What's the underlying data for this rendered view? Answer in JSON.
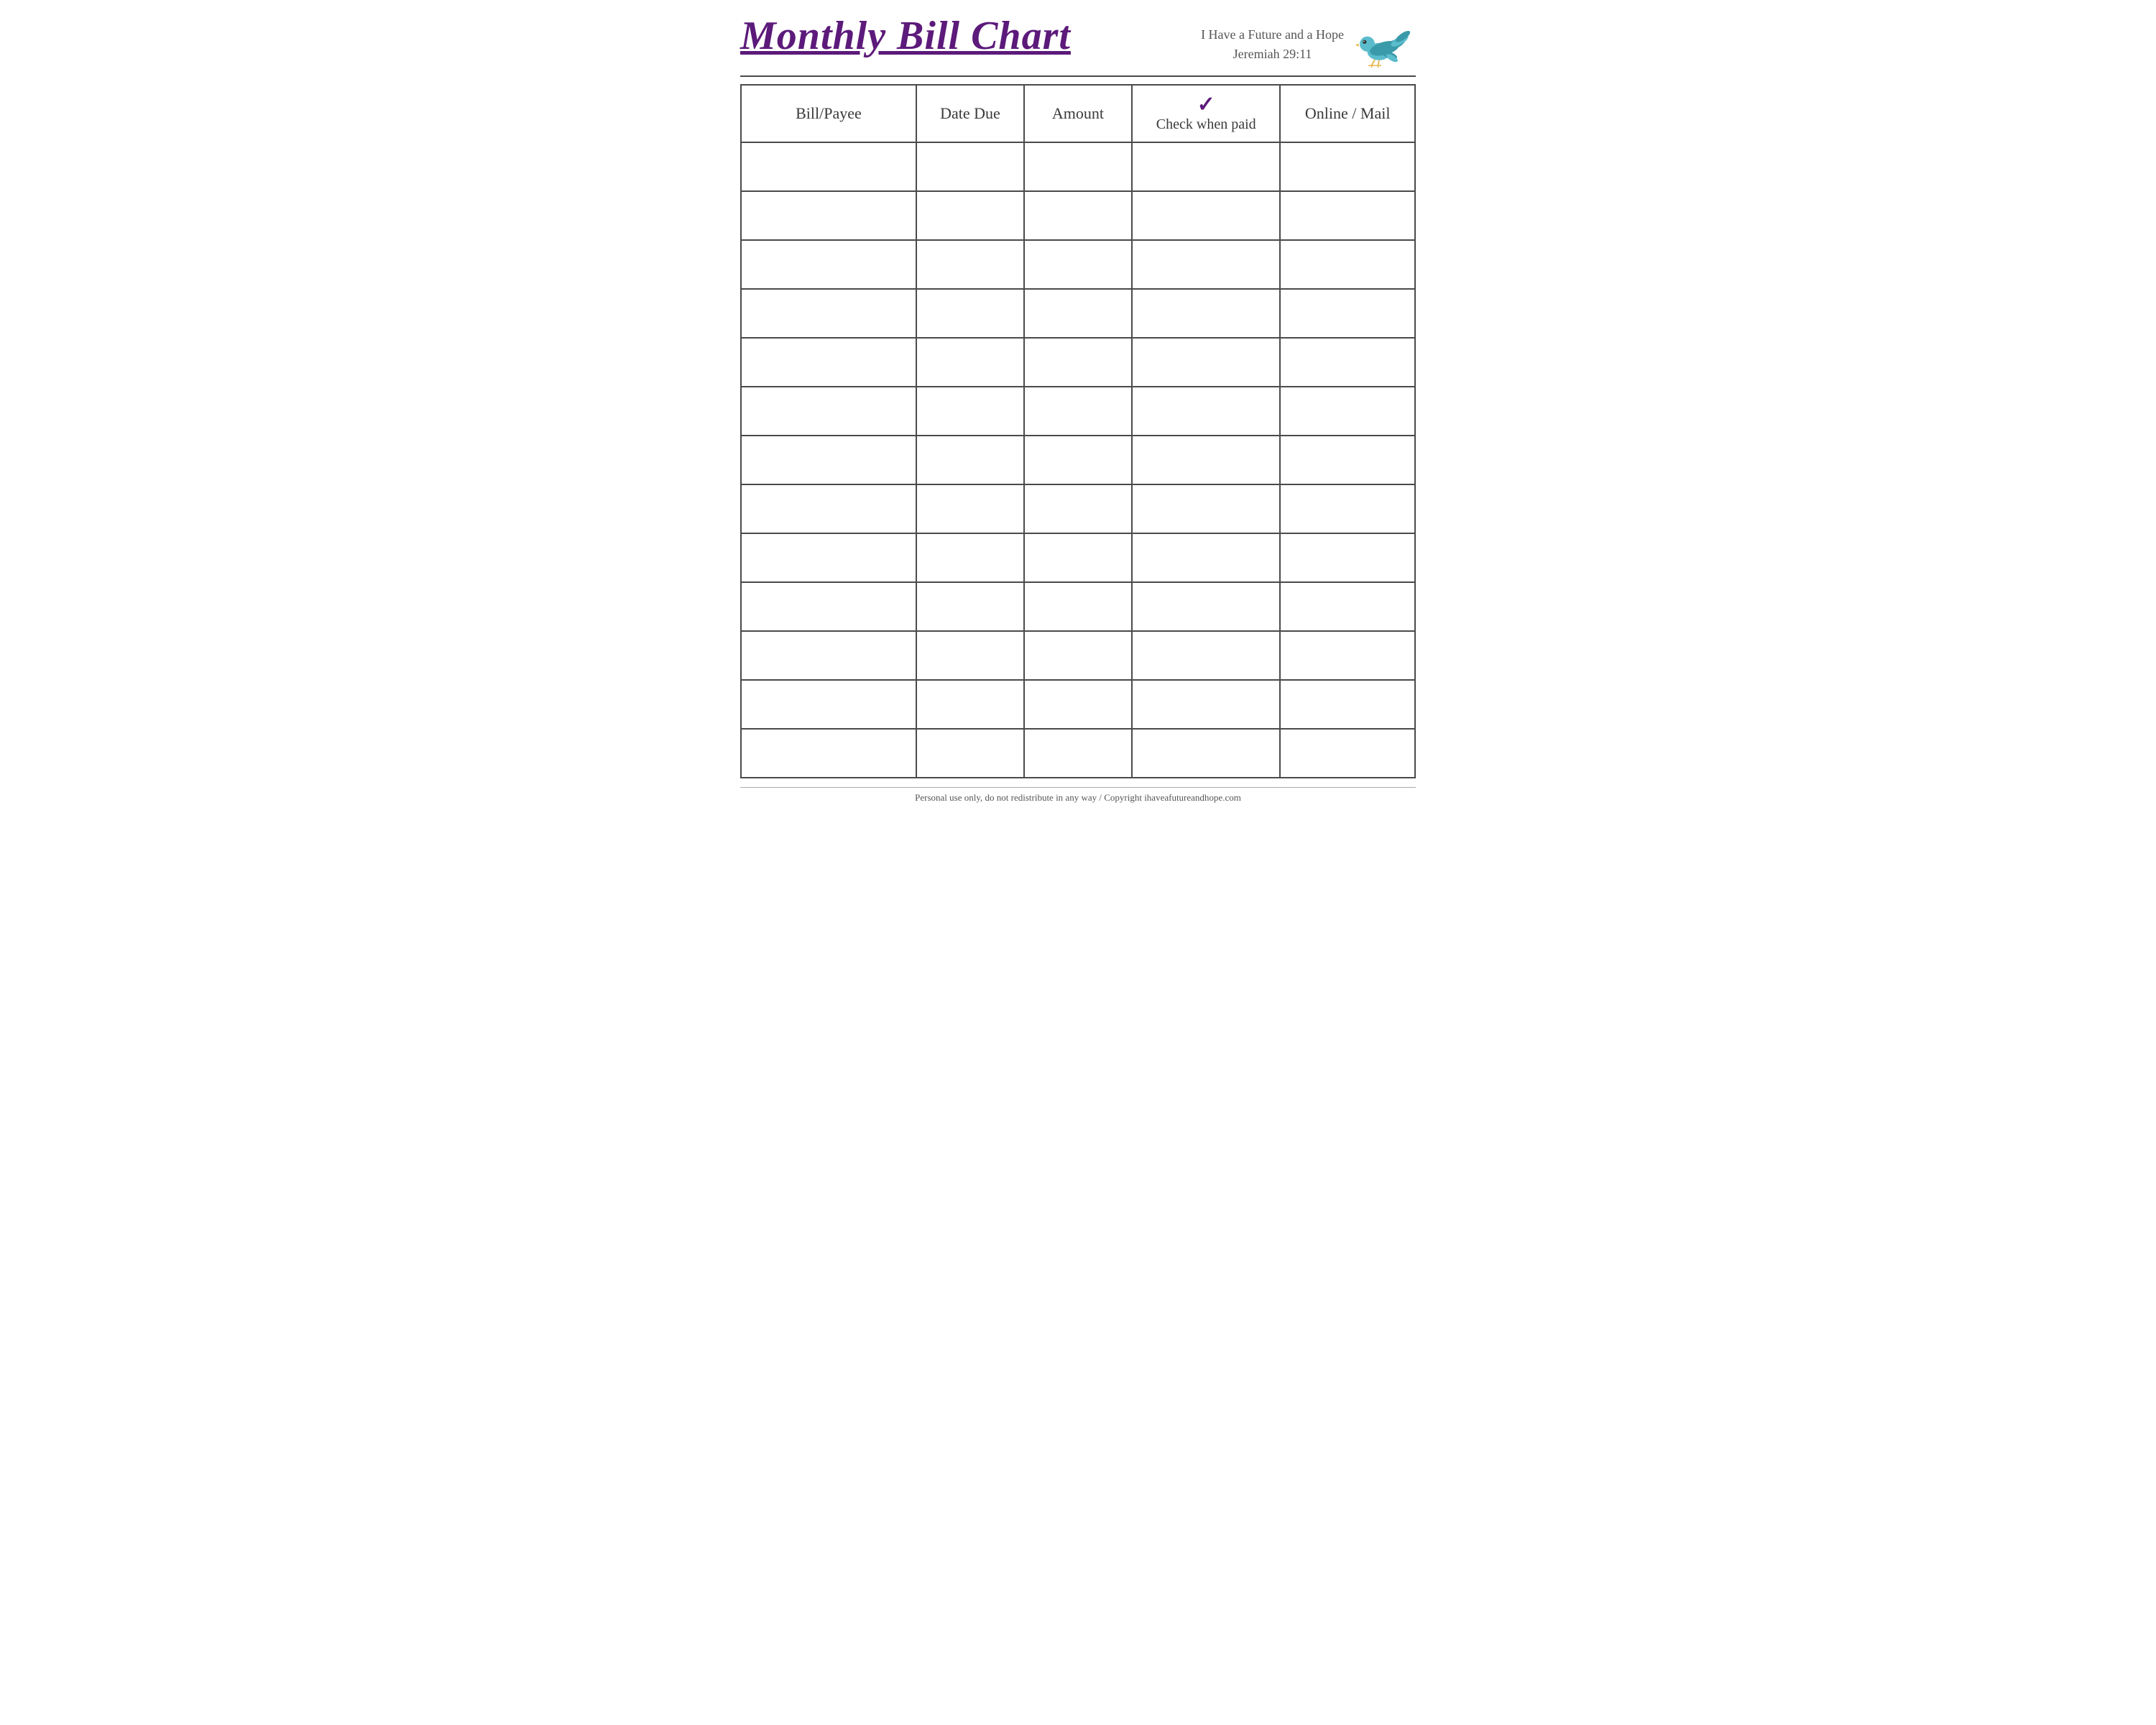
{
  "header": {
    "title": "Monthly Bill Chart",
    "scripture_line1": "I Have a Future and a Hope",
    "scripture_line2": "Jeremiah 29:11"
  },
  "table": {
    "columns": [
      {
        "id": "bill-payee",
        "label": "Bill/Payee"
      },
      {
        "id": "date-due",
        "label": "Date Due"
      },
      {
        "id": "amount",
        "label": "Amount"
      },
      {
        "id": "check-when-paid",
        "label": "Check when paid",
        "check_mark": "✓"
      },
      {
        "id": "online-mail",
        "label": "Online / Mail"
      }
    ],
    "row_count": 13
  },
  "footer": {
    "text": "Personal use only, do not redistribute in any way / Copyright ihaveafutureandhope.com"
  }
}
